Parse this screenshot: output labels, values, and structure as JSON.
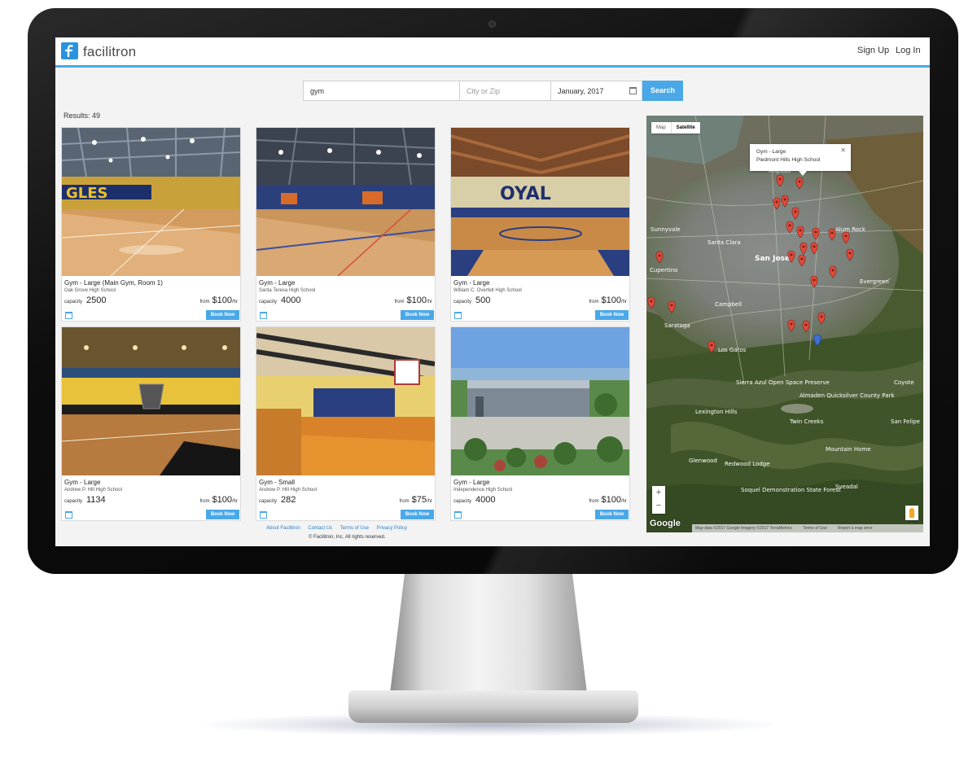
{
  "app": {
    "logo_text": "facilitron"
  },
  "header": {
    "signup_label": "Sign Up",
    "login_label": "Log In"
  },
  "search": {
    "keyword_value": "gym",
    "location_placeholder": "City or Zip",
    "date_value": "January, 2017",
    "button_label": "Search"
  },
  "results_label": "Results: 49",
  "cards": [
    {
      "title": "Gym - Large (Main Gym, Room 1)",
      "school": "Oak Grove High School",
      "capacity_label": "capacity",
      "capacity": "2500",
      "from_label": "from",
      "price": "$100",
      "unit": "/hr",
      "book_label": "Book Now"
    },
    {
      "title": "Gym - Large",
      "school": "Santa Teresa High School",
      "capacity_label": "capacity",
      "capacity": "4000",
      "from_label": "from",
      "price": "$100",
      "unit": "/hr",
      "book_label": "Book Now"
    },
    {
      "title": "Gym - Large",
      "school": "William C. Overfelt High School",
      "capacity_label": "capacity",
      "capacity": "500",
      "from_label": "from",
      "price": "$100",
      "unit": "/hr",
      "book_label": "Book Now"
    },
    {
      "title": "Gym - Large",
      "school": "Andrew P. Hill High School",
      "capacity_label": "capacity",
      "capacity": "1134",
      "from_label": "from",
      "price": "$100",
      "unit": "/hr",
      "book_label": "Book Now"
    },
    {
      "title": "Gym - Small",
      "school": "Andrew P. Hill High School",
      "capacity_label": "capacity",
      "capacity": "282",
      "from_label": "from",
      "price": "$75",
      "unit": "/hr",
      "book_label": "Book Now"
    },
    {
      "title": "Gym - Large",
      "school": "Independence High School",
      "capacity_label": "capacity",
      "capacity": "4000",
      "from_label": "from",
      "price": "$100",
      "unit": "/hr",
      "book_label": "Book Now"
    }
  ],
  "footer": {
    "links": [
      "About Facilitron",
      "Contact Us",
      "Terms of Use",
      "Privacy Policy"
    ],
    "copyright": "© Facilitron, Inc. All rights reserved."
  },
  "map": {
    "tabs": [
      "Map",
      "Satellite"
    ],
    "active_tab": "Satellite",
    "popup_title": "Gym - Large",
    "popup_school": "Piedmont Hills High School",
    "popup_close": "✕",
    "zoom_in": "+",
    "zoom_out": "−",
    "google_label": "Google",
    "attribution": [
      "Map data ©2017 Google Imagery ©2017 TerraMetrics",
      "Terms of Use",
      "Report a map error"
    ],
    "place_labels": [
      "Sunnyvale",
      "Santa Clara",
      "San Jose",
      "Cupertino",
      "Campbell",
      "Saratoga",
      "Los Gatos",
      "Alum Rock",
      "Evergreen",
      "Sierra Azul Open Space Preserve",
      "Almaden Quicksilver County Park",
      "Twin Creeks",
      "Lexington Hills",
      "Redwood Lodge",
      "Sveadal",
      "Mountain Home",
      "Soquel Demonstration State Forest",
      "San Felipe",
      "Coyote",
      "Glenwood",
      "Milpitas"
    ],
    "colors": {
      "pin": "#e04b3c",
      "pin_selected": "#3d6fd9"
    }
  },
  "colors": {
    "accent": "#4aa8e8",
    "link": "#2a7fc8"
  }
}
